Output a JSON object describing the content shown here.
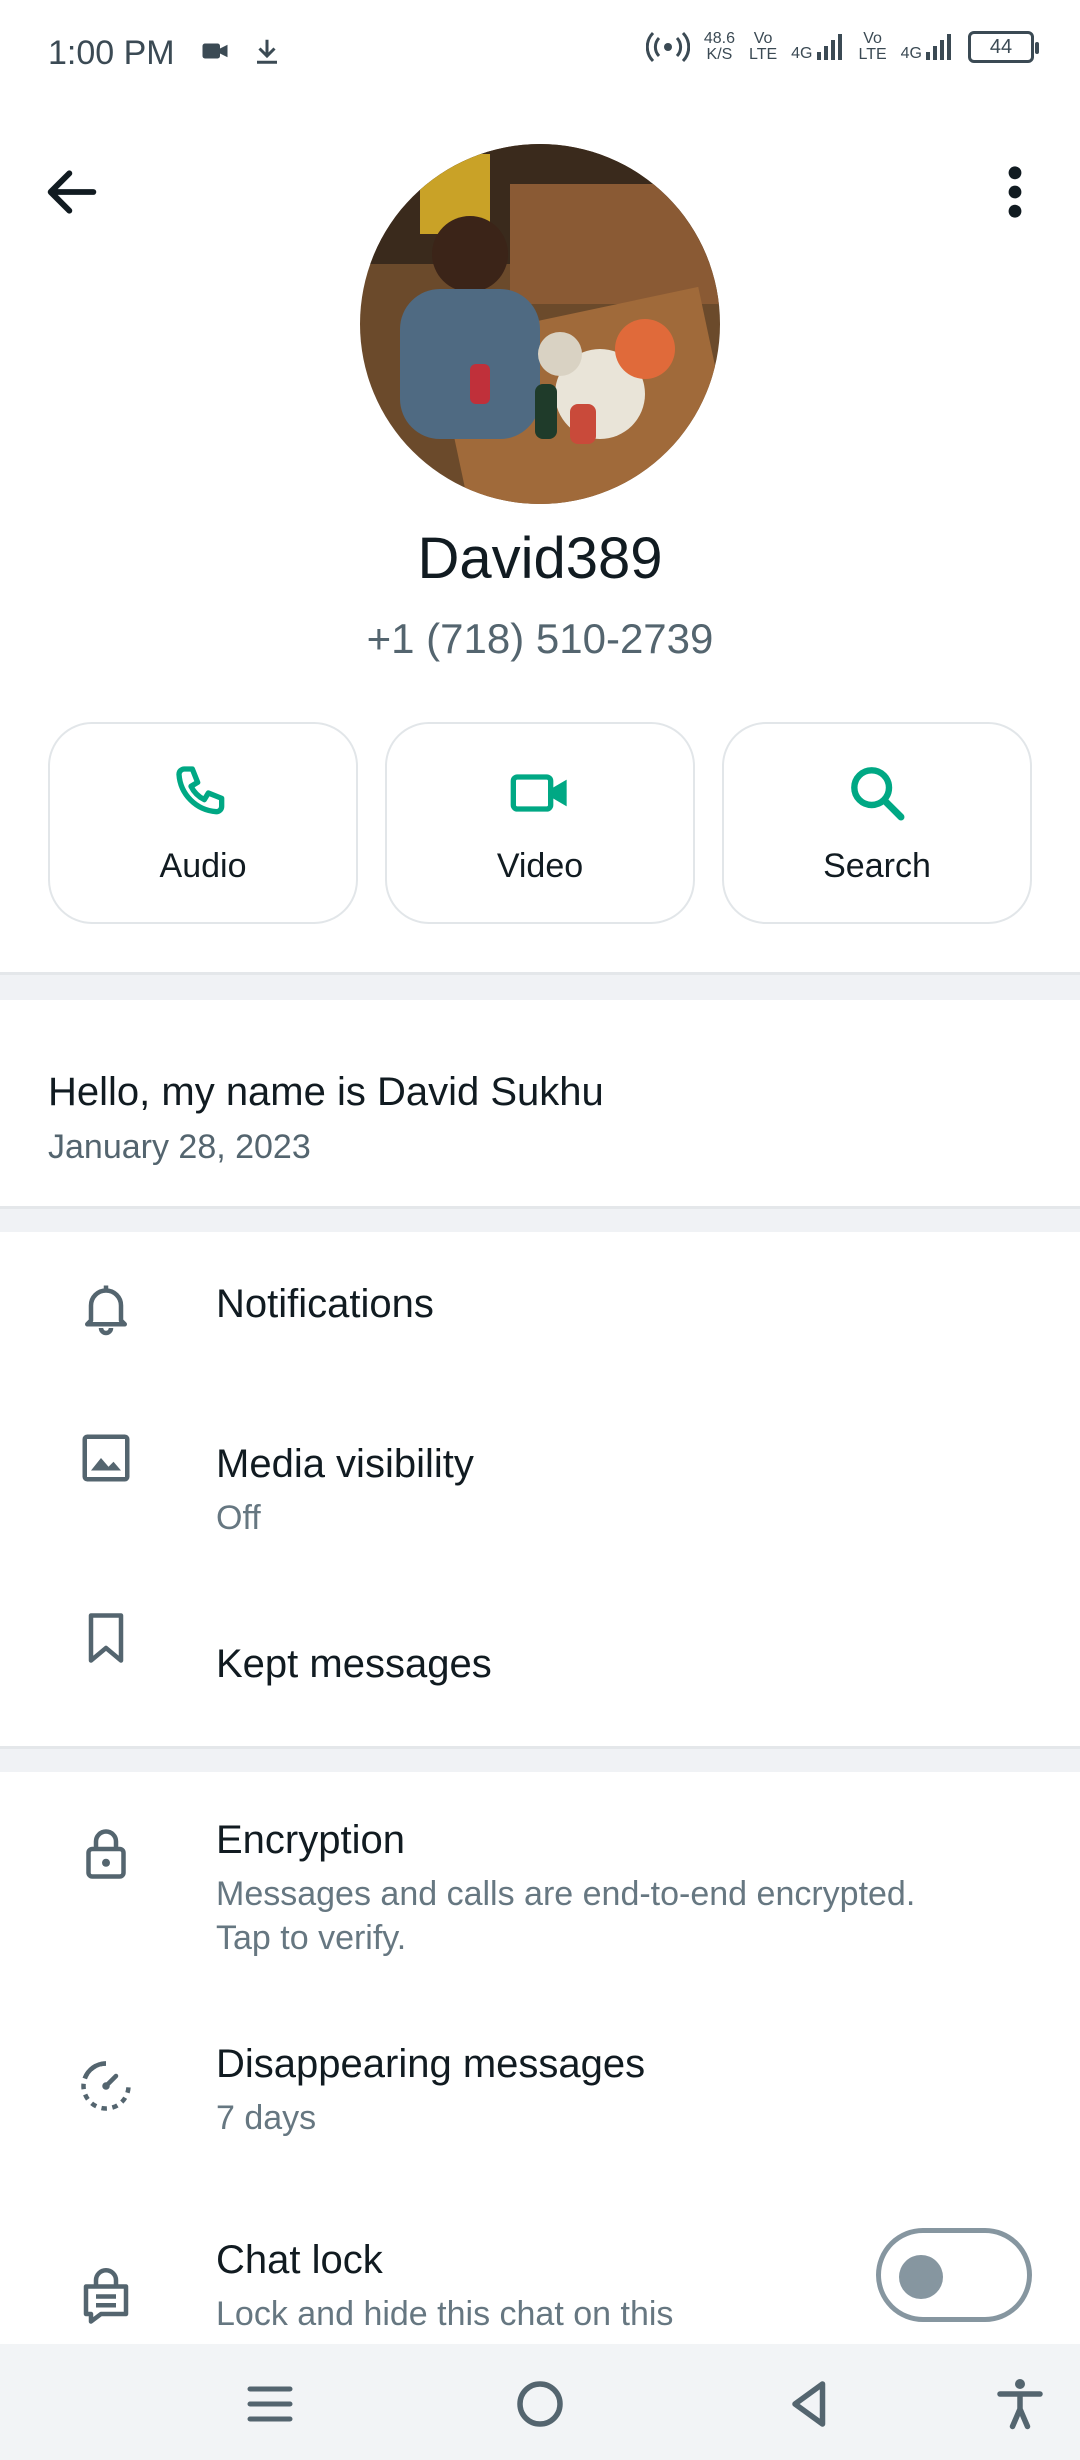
{
  "status_bar": {
    "time": "1:00 PM",
    "net_speed_value": "48.6",
    "net_speed_unit": "K/S",
    "sim1_label_top": "Vo",
    "sim1_label_bottom": "LTE",
    "sim1_network": "4G",
    "sim2_label_top": "Vo",
    "sim2_label_bottom": "LTE",
    "sim2_network": "4G",
    "battery": "44",
    "icons": [
      "video-camera-icon",
      "download-icon",
      "hotspot-icon",
      "signal-icon",
      "battery-icon"
    ]
  },
  "header": {
    "back_icon": "arrow-left-icon",
    "more_icon": "more-vertical-icon"
  },
  "contact": {
    "name": "David389",
    "phone": "+1 (718) 510-2739"
  },
  "actions": [
    {
      "label": "Audio",
      "icon": "phone-icon"
    },
    {
      "label": "Video",
      "icon": "video-icon"
    },
    {
      "label": "Search",
      "icon": "search-icon"
    }
  ],
  "about": {
    "text": "Hello, my name is David Sukhu",
    "date": "January 28, 2023"
  },
  "settings_group_1": [
    {
      "title": "Notifications",
      "icon": "bell-icon"
    },
    {
      "title": "Media visibility",
      "subtitle": "Off",
      "icon": "image-icon"
    },
    {
      "title": "Kept messages",
      "icon": "bookmark-icon"
    }
  ],
  "settings_group_2": [
    {
      "title": "Encryption",
      "subtitle": "Messages and calls are end-to-end encrypted. Tap to verify.",
      "icon": "lock-icon"
    },
    {
      "title": "Disappearing messages",
      "subtitle": "7 days",
      "icon": "timer-icon"
    },
    {
      "title": "Chat lock",
      "subtitle": "Lock and hide this chat on this",
      "icon": "chat-lock-icon",
      "toggle_on": false
    }
  ],
  "colors": {
    "accent": "#00a884",
    "text_primary": "#111b21",
    "text_secondary": "#667781",
    "icon_gray": "#54656f"
  }
}
